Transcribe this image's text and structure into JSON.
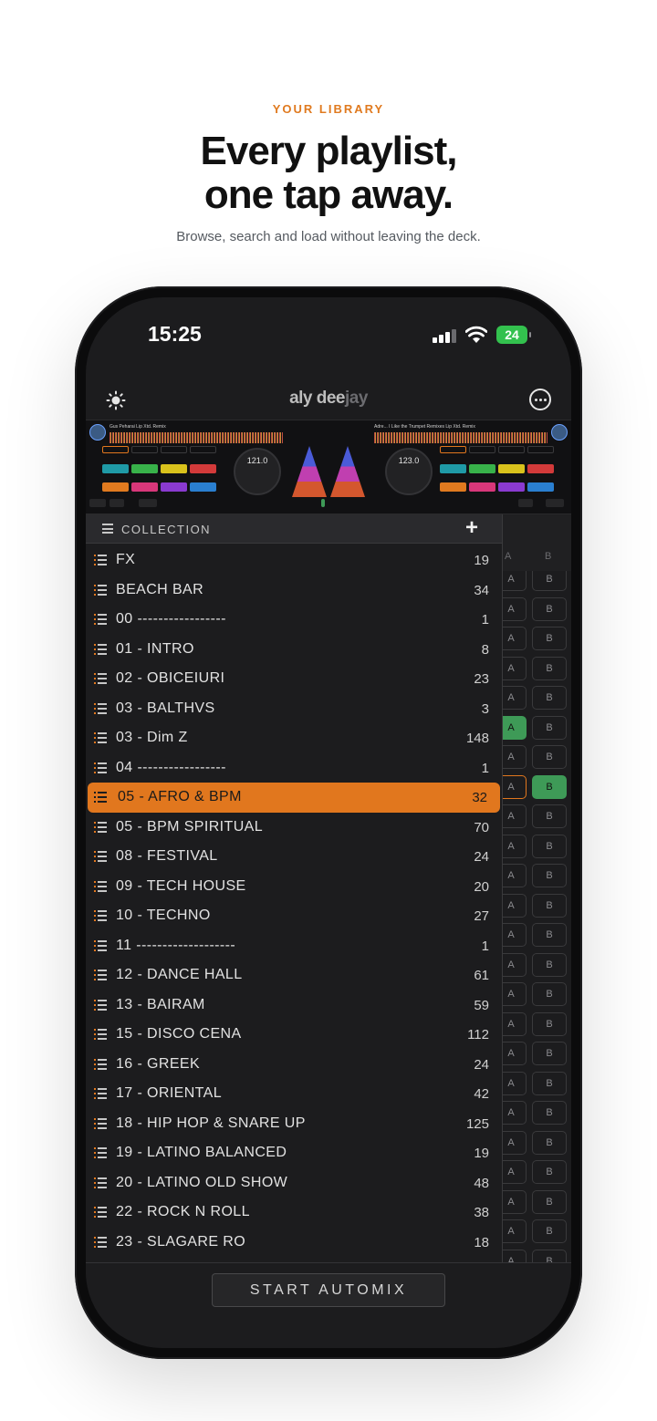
{
  "hero": {
    "kicker": "YOUR LIBRARY",
    "headline_1": "Every playlist,",
    "headline_2": "one tap away.",
    "subline": "Browse, search and load without leaving the deck."
  },
  "status_bar": {
    "time": "15:25",
    "battery": "24"
  },
  "app": {
    "logo_main": "aly dee",
    "logo_dim": "jay"
  },
  "decks": {
    "left": {
      "title": "Gus Peharai Lip Xtd. Remix",
      "bpm": "121.0"
    },
    "right": {
      "title": "Adre... I Like the Trumpet Remixes Lip Xtd. Remix",
      "bpm": "123.0"
    }
  },
  "collection": {
    "title": "COLLECTION",
    "add_symbol": "+",
    "col_a": "A",
    "col_b": "B",
    "playlists": [
      {
        "name": "FX",
        "count": "19"
      },
      {
        "name": "BEACH BAR",
        "count": "34"
      },
      {
        "name": "00 -----------------",
        "count": "1"
      },
      {
        "name": "01 - INTRO",
        "count": "8"
      },
      {
        "name": "02 - OBICEIURI",
        "count": "23"
      },
      {
        "name": "03 - BALTHVS",
        "count": "3"
      },
      {
        "name": "03 - Dim Z",
        "count": "148"
      },
      {
        "name": "04 -----------------",
        "count": "1"
      },
      {
        "name": "05 - AFRO & BPM",
        "count": "32",
        "selected": true
      },
      {
        "name": "05 - BPM SPIRITUAL",
        "count": "70"
      },
      {
        "name": "08 - FESTIVAL",
        "count": "24"
      },
      {
        "name": "09 - TECH HOUSE",
        "count": "20"
      },
      {
        "name": "10 - TECHNO",
        "count": "27"
      },
      {
        "name": "11 -------------------",
        "count": "1"
      },
      {
        "name": "12 - DANCE HALL",
        "count": "61"
      },
      {
        "name": "13 - BAIRAM",
        "count": "59"
      },
      {
        "name": "15 - DISCO CENA",
        "count": "112"
      },
      {
        "name": "16 - GREEK",
        "count": "24"
      },
      {
        "name": "17 - ORIENTAL",
        "count": "42"
      },
      {
        "name": "18 - HIP HOP & SNARE UP",
        "count": "125"
      },
      {
        "name": "19 - LATINO BALANCED",
        "count": "19"
      },
      {
        "name": "20 - LATINO OLD SHOW",
        "count": "48"
      },
      {
        "name": "22 - ROCK N ROLL",
        "count": "38"
      },
      {
        "name": "23 - SLAGARE RO",
        "count": "18"
      }
    ]
  },
  "footer": {
    "automix_label": "START AUTOMIX"
  },
  "colors": {
    "accent": "#e1771e",
    "loaded_green": "#3e9a57",
    "background": "#1c1c1e"
  }
}
